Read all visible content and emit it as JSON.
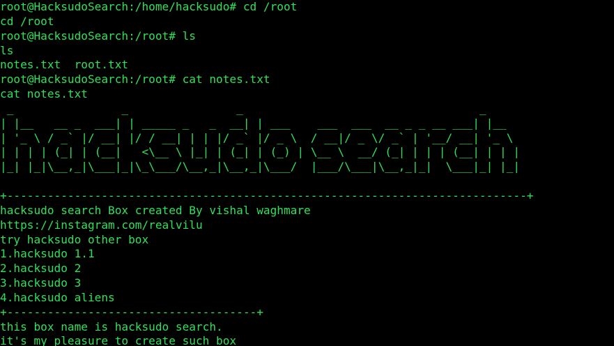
{
  "terminal": {
    "colors": {
      "background": "#000000",
      "text": "#31e05a"
    },
    "lines": [
      "root@HacksudoSearch:/home/hacksudo# cd /root",
      "cd /root",
      "root@HacksudoSearch:/root# ls",
      "ls",
      "notes.txt  root.txt",
      "root@HacksudoSearch:/root# cat notes.txt",
      "cat notes.txt",
      " _                _                _                                   _",
      "| |__   __ _  ___| | _____ _   _  __| | ___    ___  ___  __ _ _ __ ___| |__",
      "| '_ \\ / _` |/ __| |/ / __| | | |/ _` |/ _ \\  / __|/ _ \\/ _` | '__/ __| '_ \\",
      "| | | | (_| | (__|   <\\__ \\ |_| | (_| | (_) | \\__ \\  __/ (_| | | | (__| | | |",
      "|_| |_|\\__,_|\\___|_|\\_\\___/\\__,_|\\__,_|\\___/  |___/\\___|\\__,_|_|  \\___|_| |_|",
      "",
      "+-----------------------------------------------------------------------------+",
      "hacksudo search Box created By vishal waghmare",
      "https://instagram.com/realvilu",
      "try hacksudo other box",
      "1.hacksudo 1.1",
      "2.hacksudo 2",
      "3.hacksudo 3",
      "4.hacksudo aliens",
      "+-------------------------------------+",
      "this box name is hacksudo search.",
      "it's my pleasure to create such box"
    ]
  }
}
